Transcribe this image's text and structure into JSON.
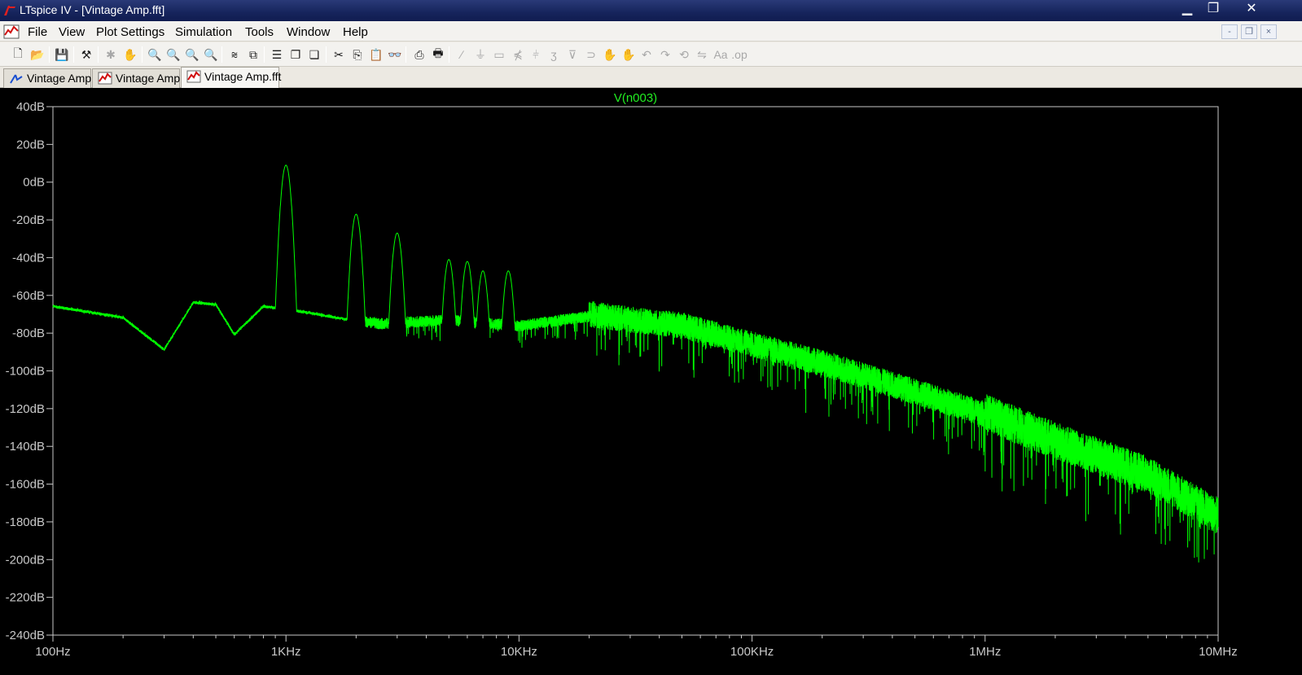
{
  "window": {
    "title": "LTspice IV - [Vintage Amp.fft]",
    "minimize": "▁",
    "restore": "❐",
    "close": "✕"
  },
  "menu": {
    "items": [
      "File",
      "View",
      "Plot Settings",
      "Simulation",
      "Tools",
      "Window",
      "Help"
    ],
    "mdi_buttons": [
      "-",
      "❐",
      "×"
    ]
  },
  "toolbar": {
    "icons": [
      "new-schematic-icon",
      "open-icon",
      "save-icon",
      "control-panel-icon",
      "run-icon",
      "halt-icon",
      "zoom-area-icon",
      "zoom-in-icon",
      "zoom-out-icon",
      "zoom-fit-icon",
      "autorange-icon",
      "mark-data-icon",
      "tile-horizontal-icon",
      "cascade-icon",
      "tile-vertical-icon",
      "cut-icon",
      "copy-icon",
      "paste-icon",
      "find-icon",
      "print-preview-icon",
      "print-icon",
      "wire-icon",
      "ground-icon",
      "label-icon",
      "resistor-icon",
      "capacitor-icon",
      "inductor-icon",
      "diode-icon",
      "component-icon",
      "move-icon",
      "drag-icon",
      "undo-icon",
      "redo-icon",
      "rotate-icon",
      "mirror-icon",
      "text-icon",
      "spice-directive-icon"
    ]
  },
  "tabs": [
    {
      "label": "Vintage Amp",
      "icon": "schematic-icon",
      "active": false
    },
    {
      "label": "Vintage Amp",
      "icon": "waveform-icon",
      "active": false
    },
    {
      "label": "Vintage Amp.fft",
      "icon": "waveform-icon",
      "active": true
    }
  ],
  "colors": {
    "trace": "#00ff00",
    "background": "#000000",
    "axis": "#c8c8c8",
    "label": "#22ee22"
  },
  "chart_data": {
    "type": "line",
    "title": "V(n003)",
    "series": [
      {
        "name": "V(n003)",
        "color": "#00ff00"
      }
    ],
    "x_scale": "log",
    "xlim": [
      100,
      10000000
    ],
    "x_ticks": [
      "100Hz",
      "1KHz",
      "10KHz",
      "100KHz",
      "1MHz",
      "10MHz"
    ],
    "ylim": [
      -240,
      40
    ],
    "y_ticks": [
      "40dB",
      "20dB",
      "0dB",
      "-20dB",
      "-40dB",
      "-60dB",
      "-80dB",
      "-100dB",
      "-120dB",
      "-140dB",
      "-160dB",
      "-180dB",
      "-200dB",
      "-220dB",
      "-240dB"
    ],
    "peaks_hz_db": [
      [
        1000,
        9
      ],
      [
        2000,
        -17
      ],
      [
        3000,
        -27
      ],
      [
        5000,
        -41
      ],
      [
        6000,
        -42
      ],
      [
        7000,
        -47
      ],
      [
        9000,
        -47
      ]
    ],
    "envelope_points_hz_db": [
      [
        100,
        -66
      ],
      [
        200,
        -72
      ],
      [
        300,
        -89
      ],
      [
        400,
        -64
      ],
      [
        500,
        -65
      ],
      [
        600,
        -81
      ],
      [
        800,
        -66
      ],
      [
        1200,
        -69
      ],
      [
        2500,
        -76
      ],
      [
        5000,
        -74
      ],
      [
        10000,
        -77
      ],
      [
        20000,
        -72
      ],
      [
        30000,
        -75
      ],
      [
        50000,
        -78
      ],
      [
        100000,
        -88
      ],
      [
        200000,
        -98
      ],
      [
        500000,
        -113
      ],
      [
        1000000,
        -125
      ],
      [
        2000000,
        -140
      ],
      [
        5000000,
        -158
      ],
      [
        10000000,
        -180
      ]
    ],
    "grid": false
  }
}
